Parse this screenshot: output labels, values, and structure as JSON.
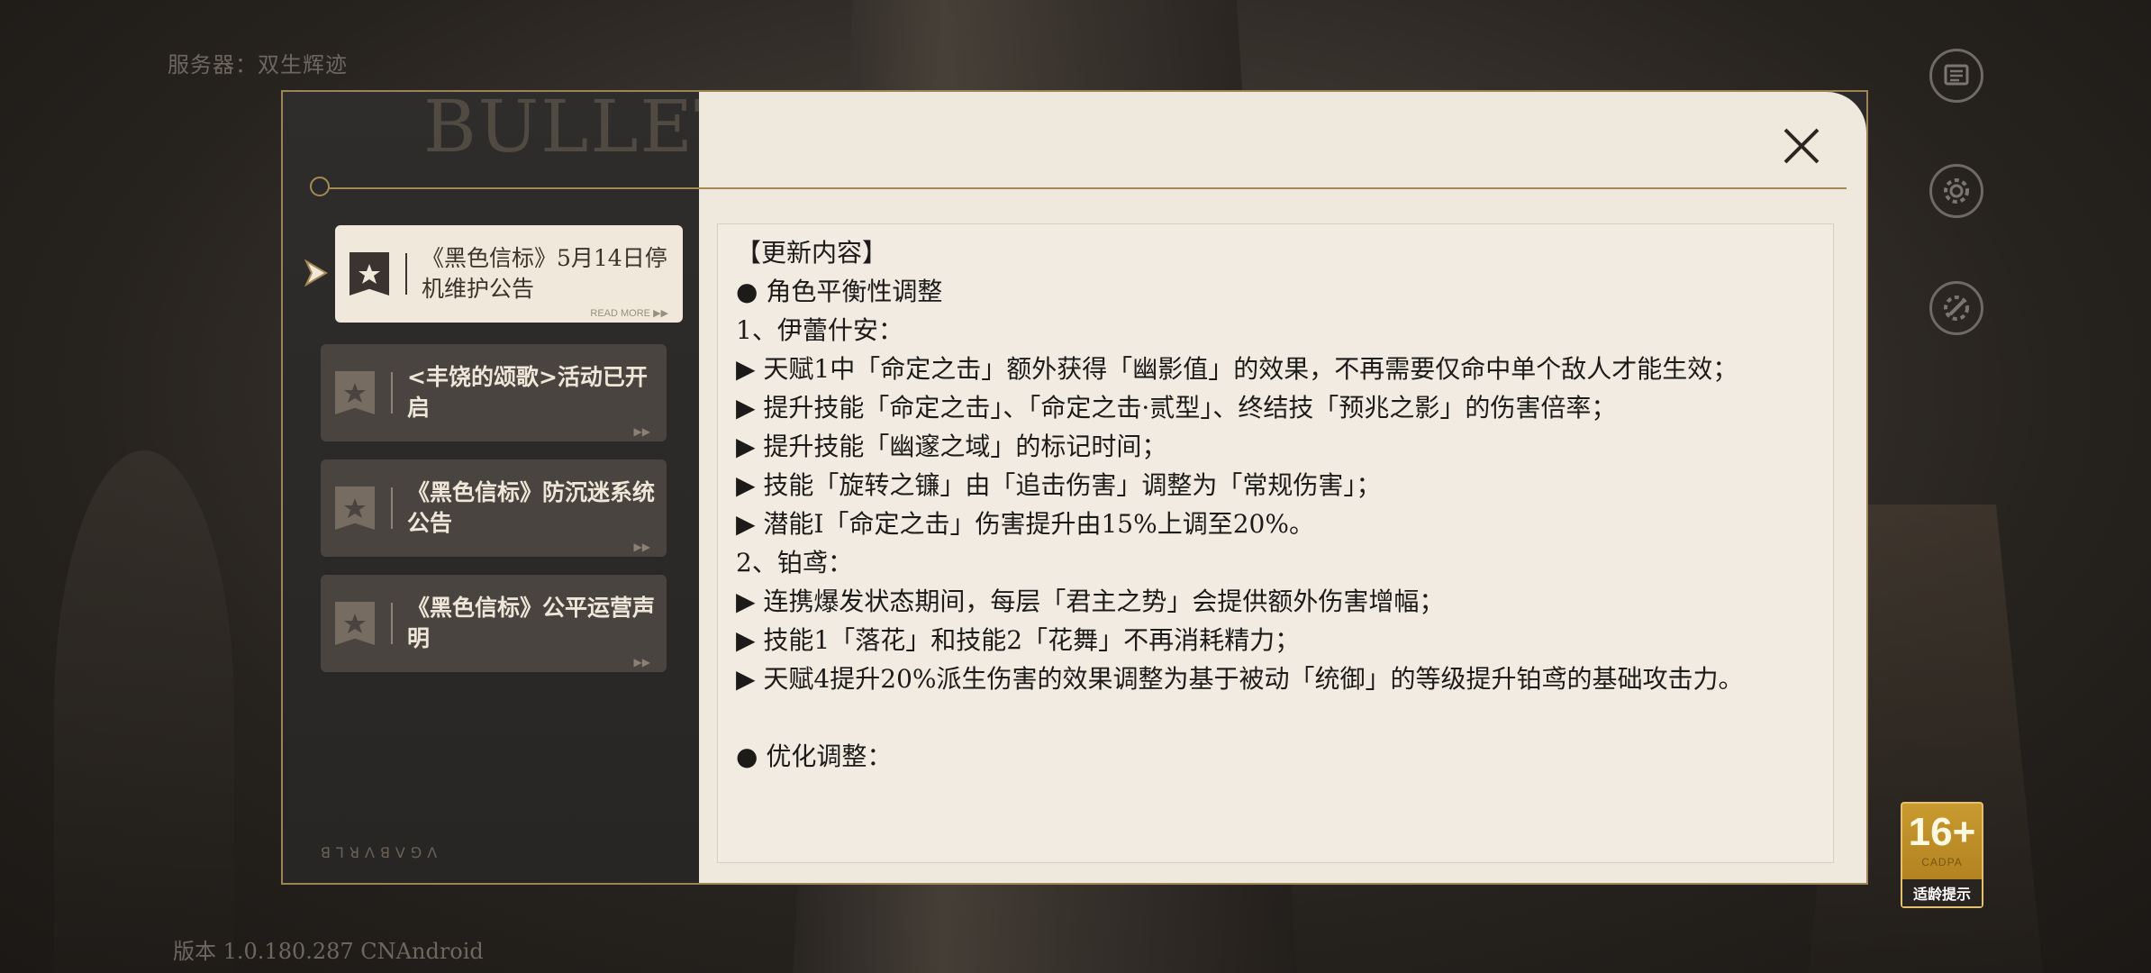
{
  "server": {
    "text": "服务器：双生辉迹"
  },
  "version": {
    "text": "版本 1.0.180.287 CNAndroid"
  },
  "modal": {
    "watermark": "BULLET",
    "notices": [
      {
        "label": "《黑色信标》5月14日停机维护公告",
        "read_more": "READ MORE ▶▶",
        "active": true
      },
      {
        "label": "<丰饶的颂歌>活动已开启",
        "active": false
      },
      {
        "label": "《黑色信标》防沉迷系统公告",
        "active": false
      },
      {
        "label": "《黑色信标》公平运营声明",
        "active": false
      }
    ],
    "arrows": "▶▶",
    "content_lines": [
      "【更新内容】",
      "● 角色平衡性调整",
      "1、伊蕾什安：",
      "▶ 天赋1中「命定之击」额外获得「幽影值」的效果，不再需要仅命中单个敌人才能生效；",
      "▶ 提升技能「命定之击」、「命定之击·贰型」、终结技「预兆之影」的伤害倍率；",
      "▶ 提升技能「幽邃之域」的标记时间；",
      "▶ 技能「旋转之镰」由「追击伤害」调整为「常规伤害」；",
      "▶ 潜能I「命定之击」伤害提升由15%上调至20%。",
      "2、铂鸢：",
      "▶ 连携爆发状态期间，每层「君主之势」会提供额外伤害增幅；",
      "▶ 技能1「落花」和技能2「花舞」不再消耗精力；",
      "▶ 天赋4提升20%派生伤害的效果调整为基于被动「统御」的等级提升铂鸢的基础攻击力。",
      "",
      "● 优化调整："
    ]
  },
  "age_rating": {
    "age": "16+",
    "org": "CADPA",
    "tip": "适龄提示"
  },
  "icons": {
    "notice": "notice-icon",
    "settings": "gear-icon",
    "tools": "tools-icon",
    "close": "close-icon",
    "item": "star-bookmark-icon"
  }
}
